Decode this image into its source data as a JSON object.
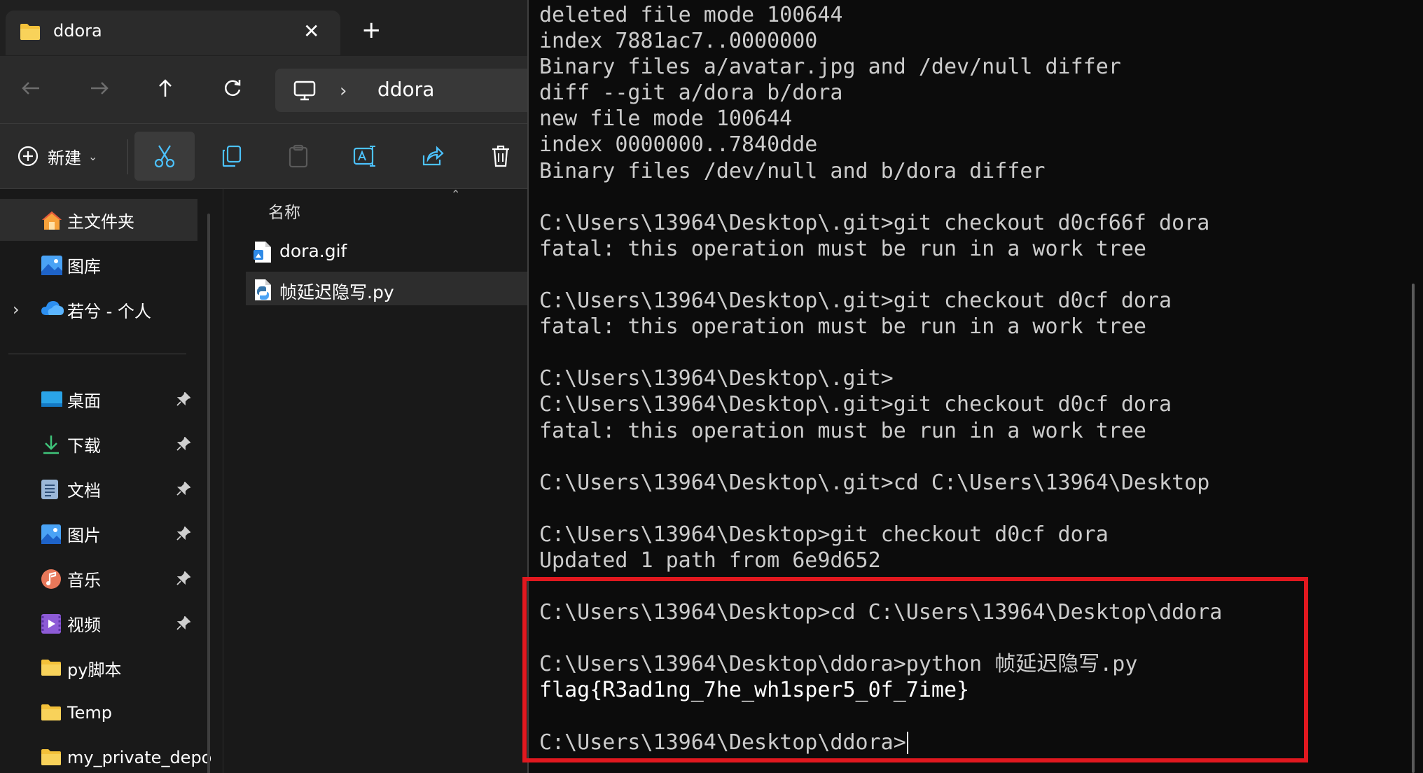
{
  "explorer": {
    "tab": {
      "title": "ddora",
      "close_glyph": "✕",
      "new_tab_glyph": "+"
    },
    "address": {
      "segment": "ddora",
      "separator": "›"
    },
    "toolbar": {
      "new_label": "新建",
      "buttons": [
        "scissors-icon",
        "copy-icon",
        "paste-icon",
        "rename-icon",
        "share-icon",
        "trash-icon"
      ]
    },
    "nav": {
      "items": [
        {
          "label": "主文件夹",
          "icon": "home-icon"
        },
        {
          "label": "图库",
          "icon": "gallery-icon"
        },
        {
          "label": "若兮 - 个人",
          "icon": "cloud-icon"
        },
        {
          "label": "桌面",
          "icon": "desktop-icon",
          "pinned": true
        },
        {
          "label": "下载",
          "icon": "download-icon",
          "pinned": true
        },
        {
          "label": "文档",
          "icon": "document-icon",
          "pinned": true
        },
        {
          "label": "图片",
          "icon": "pictures-icon",
          "pinned": true
        },
        {
          "label": "音乐",
          "icon": "music-icon",
          "pinned": true
        },
        {
          "label": "视频",
          "icon": "video-icon",
          "pinned": true
        },
        {
          "label": "py脚本",
          "icon": "folder-icon"
        },
        {
          "label": "Temp",
          "icon": "folder-icon"
        },
        {
          "label": "my_private_depo",
          "icon": "folder-icon"
        }
      ],
      "expand_glyph": "›"
    },
    "files": {
      "column_header": "名称",
      "rows": [
        {
          "name": "dora.gif",
          "icon": "gif-file-icon"
        },
        {
          "name": "帧延迟隐写.py",
          "icon": "python-file-icon",
          "selected": true
        }
      ]
    }
  },
  "terminal": {
    "lines": [
      "deleted file mode 100644",
      "index 7881ac7..0000000",
      "Binary files a/avatar.jpg and /dev/null differ",
      "diff --git a/dora b/dora",
      "new file mode 100644",
      "index 0000000..7840dde",
      "Binary files /dev/null and b/dora differ",
      "",
      "C:\\Users\\13964\\Desktop\\.git>git checkout d0cf66f dora",
      "fatal: this operation must be run in a work tree",
      "",
      "C:\\Users\\13964\\Desktop\\.git>git checkout d0cf dora",
      "fatal: this operation must be run in a work tree",
      "",
      "C:\\Users\\13964\\Desktop\\.git>",
      "C:\\Users\\13964\\Desktop\\.git>git checkout d0cf dora",
      "fatal: this operation must be run in a work tree",
      "",
      "C:\\Users\\13964\\Desktop\\.git>cd C:\\Users\\13964\\Desktop",
      "",
      "C:\\Users\\13964\\Desktop>git checkout d0cf dora",
      "Updated 1 path from 6e9d652",
      "",
      "C:\\Users\\13964\\Desktop>cd C:\\Users\\13964\\Desktop\\ddora",
      "",
      "C:\\Users\\13964\\Desktop\\ddora>python 帧延迟隐写.py",
      "flag{R3ad1ng_7he_wh1sper5_0f_7ime}",
      "",
      "C:\\Users\\13964\\Desktop\\ddora>"
    ],
    "highlight_color": "#e1181f"
  },
  "colors": {
    "folder_yellow": "#f3c13a",
    "terminal_bg": "#0c0c0c",
    "explorer_bg": "#191919",
    "toolbar_bg": "#2b2b2b"
  }
}
